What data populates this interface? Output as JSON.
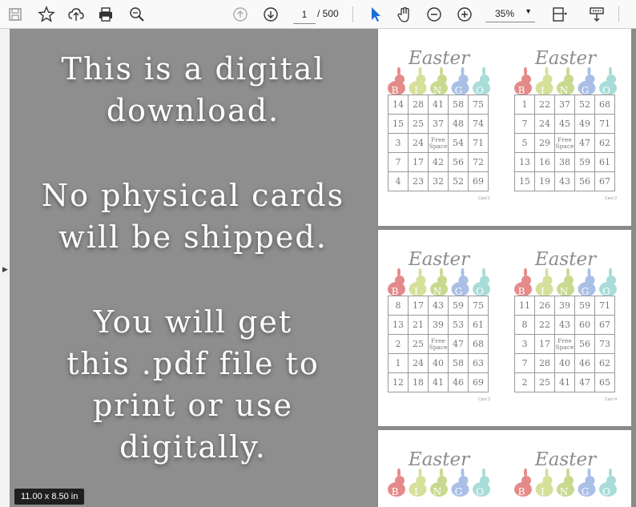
{
  "toolbar": {
    "current_page": "1",
    "total_pages": "/ 500",
    "zoom": "35%",
    "icons": [
      "save-icon",
      "bookmark-star-icon",
      "upload-cloud-icon",
      "print-icon",
      "zoom-search-icon",
      "page-up-icon",
      "page-down-icon",
      "select-cursor-icon",
      "hand-tool-icon",
      "zoom-out-icon",
      "zoom-in-icon",
      "fit-page-icon",
      "scroll-mode-icon"
    ]
  },
  "promo": {
    "line1": "This is a digital",
    "line2": "download.",
    "line3": "No physical cards",
    "line4": "will be shipped.",
    "line5": "You will get",
    "line6": "this .pdf file to",
    "line7": "print or use",
    "line8": "digitally."
  },
  "page_size": "11.00 x 8.50 in",
  "colors": {
    "b": "#e58a8a",
    "i": "#d6e09a",
    "n": "#c9d98f",
    "g": "#a9bfe6",
    "o": "#a8dcd8"
  },
  "cards": [
    {
      "title": "Easter",
      "letters": [
        "B",
        "I",
        "N",
        "G",
        "O"
      ],
      "label": "Card 1",
      "rows": [
        [
          "14",
          "28",
          "41",
          "58",
          "75"
        ],
        [
          "15",
          "25",
          "37",
          "48",
          "74"
        ],
        [
          "3",
          "24",
          "Free Space",
          "54",
          "71"
        ],
        [
          "7",
          "17",
          "42",
          "56",
          "72"
        ],
        [
          "4",
          "23",
          "32",
          "52",
          "69"
        ]
      ]
    },
    {
      "title": "Easter",
      "letters": [
        "B",
        "I",
        "N",
        "G",
        "O"
      ],
      "label": "Card 2",
      "rows": [
        [
          "1",
          "22",
          "37",
          "52",
          "68"
        ],
        [
          "7",
          "24",
          "45",
          "49",
          "71"
        ],
        [
          "5",
          "29",
          "Free Space",
          "47",
          "62"
        ],
        [
          "13",
          "16",
          "38",
          "59",
          "61"
        ],
        [
          "15",
          "19",
          "43",
          "56",
          "67"
        ]
      ]
    },
    {
      "title": "Easter",
      "letters": [
        "B",
        "I",
        "N",
        "G",
        "O"
      ],
      "label": "Card 3",
      "rows": [
        [
          "8",
          "17",
          "43",
          "59",
          "75"
        ],
        [
          "13",
          "21",
          "39",
          "53",
          "61"
        ],
        [
          "2",
          "25",
          "Free Space",
          "47",
          "68"
        ],
        [
          "1",
          "24",
          "40",
          "58",
          "63"
        ],
        [
          "12",
          "18",
          "41",
          "46",
          "69"
        ]
      ]
    },
    {
      "title": "Easter",
      "letters": [
        "B",
        "I",
        "N",
        "G",
        "O"
      ],
      "label": "Card 4",
      "rows": [
        [
          "11",
          "26",
          "39",
          "59",
          "71"
        ],
        [
          "8",
          "22",
          "43",
          "60",
          "67"
        ],
        [
          "3",
          "17",
          "Free Space",
          "56",
          "73"
        ],
        [
          "7",
          "28",
          "40",
          "46",
          "62"
        ],
        [
          "2",
          "25",
          "41",
          "47",
          "65"
        ]
      ]
    },
    {
      "title": "Easter",
      "letters": [
        "B",
        "I",
        "N",
        "G",
        "O"
      ],
      "label": "",
      "rows": []
    },
    {
      "title": "Easter",
      "letters": [
        "B",
        "I",
        "N",
        "G",
        "O"
      ],
      "label": "",
      "rows": []
    }
  ]
}
